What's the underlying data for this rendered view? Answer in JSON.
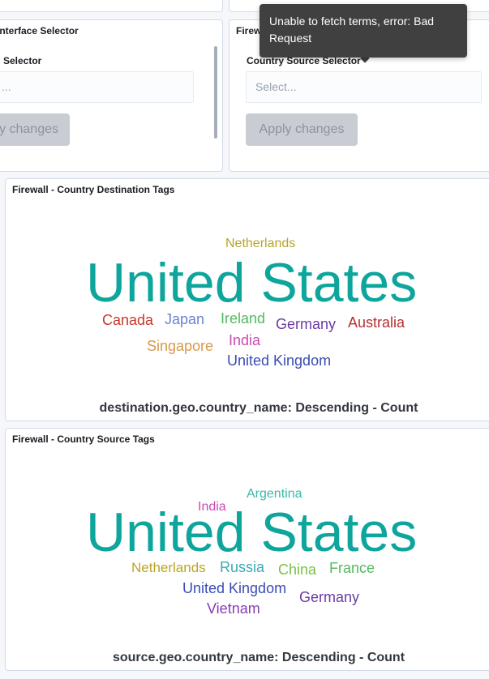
{
  "tooltip": {
    "text": "Unable to fetch terms, error: Bad Request"
  },
  "interface_panel": {
    "title": "Interface Selector",
    "control_label": "Selector",
    "select_placeholder": "...",
    "apply_label": "y changes"
  },
  "country_panel": {
    "title": "Firew",
    "control_label": "Country Source Selector",
    "select_placeholder": "Select...",
    "apply_label": "Apply changes"
  },
  "destination_cloud": {
    "title": "Firewall - Country Destination Tags",
    "caption": "destination.geo.country_name: Descending - Count",
    "tags": [
      {
        "text": "United States",
        "color": "#0da59c"
      },
      {
        "text": "Netherlands",
        "color": "#b9a526"
      },
      {
        "text": "Canada",
        "color": "#c3392b"
      },
      {
        "text": "Japan",
        "color": "#6b82d4"
      },
      {
        "text": "Ireland",
        "color": "#54b961"
      },
      {
        "text": "Germany",
        "color": "#6a3ba4"
      },
      {
        "text": "Australia",
        "color": "#b2312f"
      },
      {
        "text": "India",
        "color": "#cc49b2"
      },
      {
        "text": "Singapore",
        "color": "#d79a4a"
      },
      {
        "text": "United Kingdom",
        "color": "#3a4cb5"
      }
    ]
  },
  "source_cloud": {
    "title": "Firewall - Country Source Tags",
    "caption": "source.geo.country_name: Descending - Count",
    "tags": [
      {
        "text": "United States",
        "color": "#0da59c"
      },
      {
        "text": "Argentina",
        "color": "#3bbaa8"
      },
      {
        "text": "India",
        "color": "#cc49b2"
      },
      {
        "text": "Netherlands",
        "color": "#b9a526"
      },
      {
        "text": "Russia",
        "color": "#3aaab7"
      },
      {
        "text": "China",
        "color": "#7ac045"
      },
      {
        "text": "France",
        "color": "#54b961"
      },
      {
        "text": "United Kingdom",
        "color": "#3a4cb5"
      },
      {
        "text": "Germany",
        "color": "#6a3ba4"
      },
      {
        "text": "Vietnam",
        "color": "#8a3bb5"
      }
    ]
  }
}
